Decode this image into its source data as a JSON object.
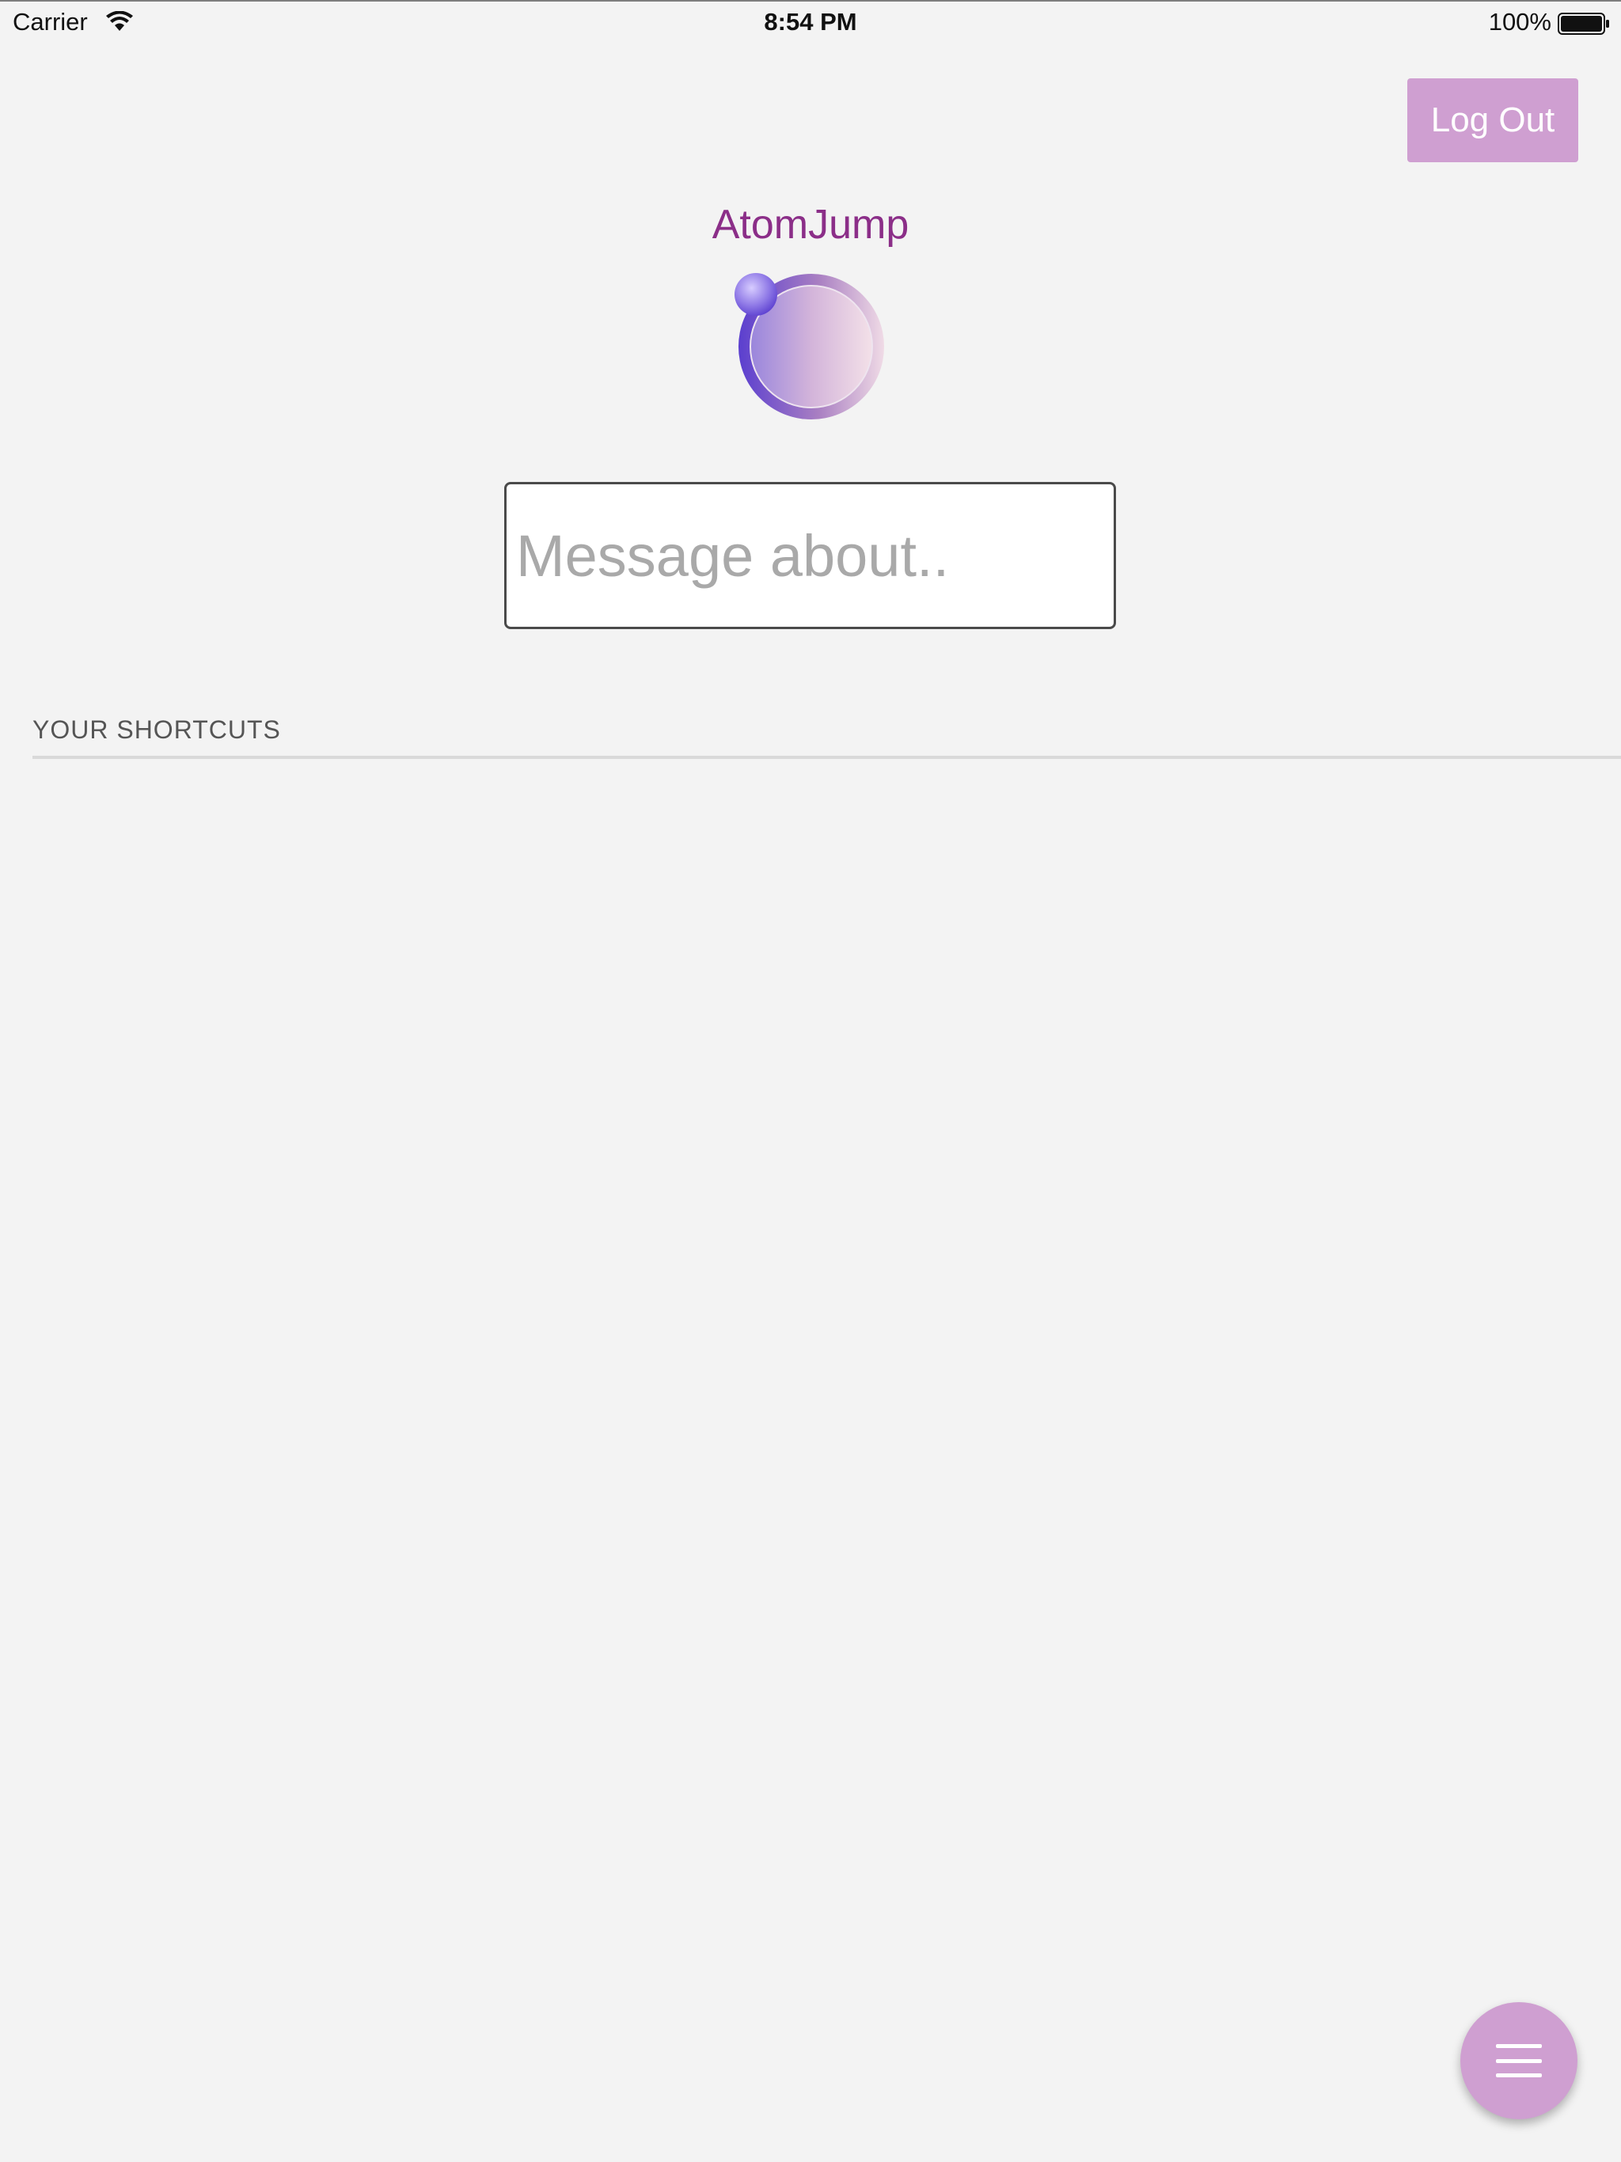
{
  "status_bar": {
    "carrier": "Carrier",
    "time": "8:54 PM",
    "battery": "100%",
    "icons": [
      "wifi-icon",
      "battery-icon"
    ]
  },
  "header": {
    "logout_label": "Log Out",
    "title": "AtomJump"
  },
  "logo": {
    "icon": "atomjump-logo",
    "colors": [
      "#5b3fcf",
      "#b98fc6",
      "#f0dbe6"
    ]
  },
  "message": {
    "placeholder": "Message about..",
    "value": ""
  },
  "shortcuts": {
    "heading": "YOUR SHORTCUTS",
    "items": []
  },
  "fab": {
    "icon": "menu-icon"
  },
  "colors": {
    "accent": "#cf9fd1",
    "title": "#8b2e88",
    "background": "#f3f3f3"
  }
}
